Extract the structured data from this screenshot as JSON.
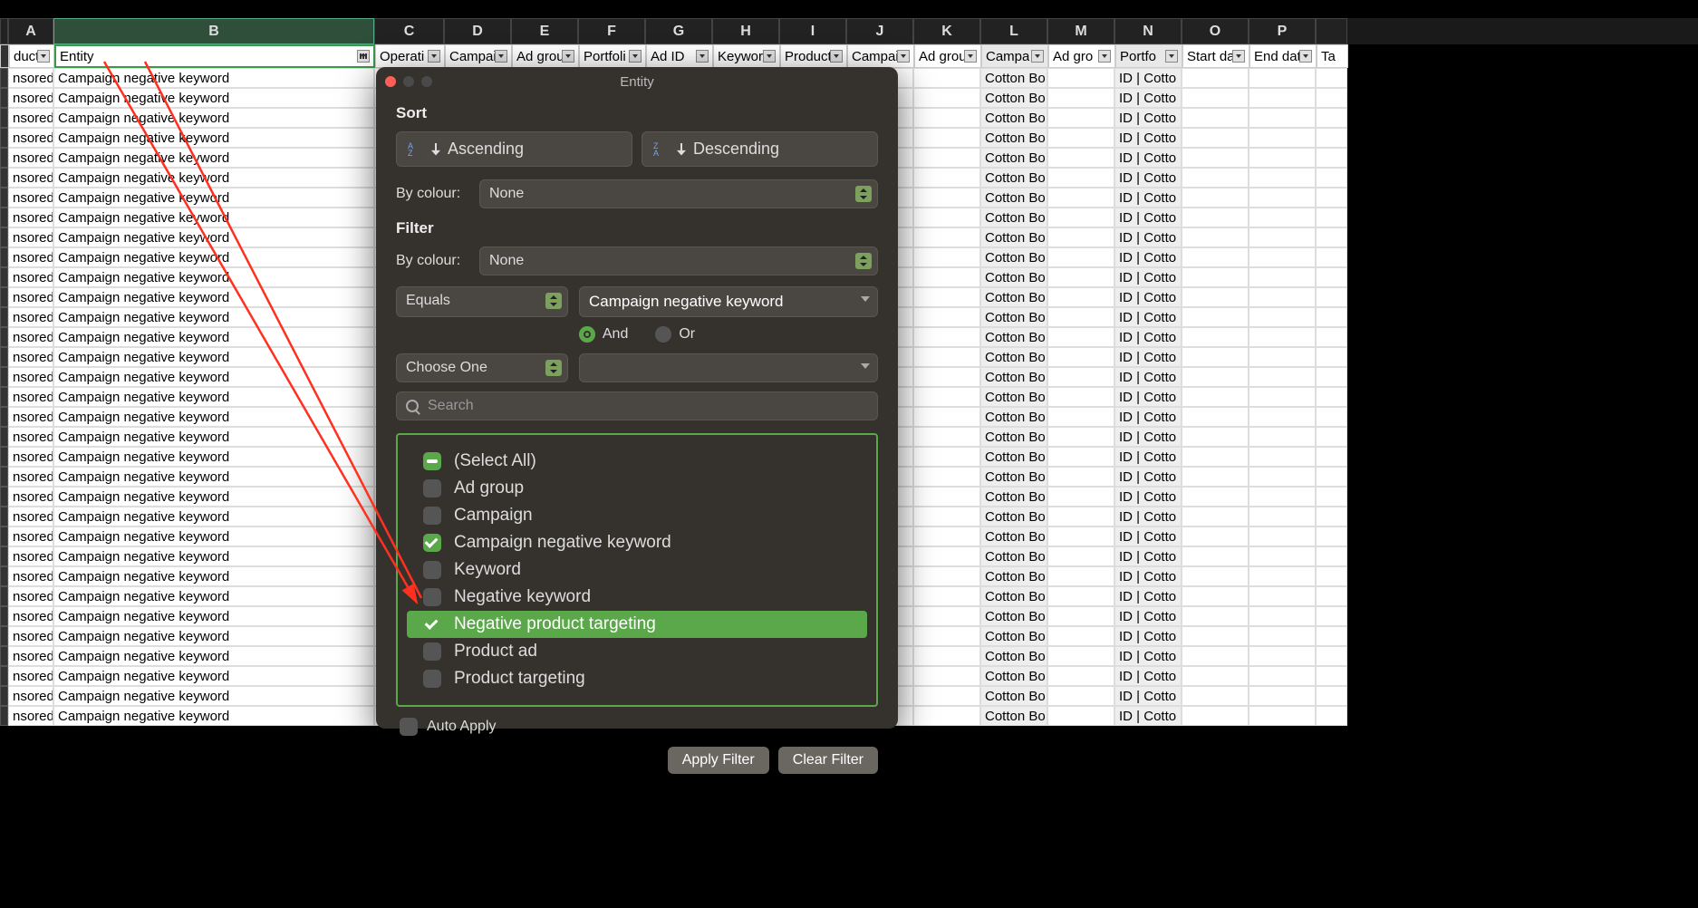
{
  "columns": [
    "A",
    "B",
    "C",
    "D",
    "E",
    "F",
    "G",
    "H",
    "I",
    "J",
    "K",
    "L",
    "M",
    "N",
    "O",
    "P"
  ],
  "filter_headers": {
    "A": "duct",
    "B": "Entity",
    "C": "Operati",
    "D": "Campai",
    "E": "Ad grou",
    "F": "Portfoli",
    "G": "Ad ID",
    "H": "Keywor",
    "I": "Product",
    "J": "Campai",
    "K": "Ad grou",
    "L": "Campa",
    "M": "Ad gro",
    "N": "Portfo",
    "O": "Start da",
    "P": "End dat",
    "Q": "Ta"
  },
  "row_data": {
    "A": "nsored",
    "B": "Campaign negative keyword",
    "L": "Cotton Bo",
    "N": "ID | Cotto"
  },
  "row_count": 33,
  "dialog": {
    "title": "Entity",
    "sort_label": "Sort",
    "asc": "Ascending",
    "desc": "Descending",
    "by_colour": "By colour:",
    "none": "None",
    "filter_label": "Filter",
    "equals": "Equals",
    "equals_value": "Campaign negative keyword",
    "and": "And",
    "or": "Or",
    "choose_one": "Choose One",
    "search_placeholder": "Search",
    "items": [
      {
        "label": "(Select All)",
        "state": "partial"
      },
      {
        "label": "Ad group",
        "state": "off"
      },
      {
        "label": "Campaign",
        "state": "off"
      },
      {
        "label": "Campaign negative keyword",
        "state": "checked"
      },
      {
        "label": "Keyword",
        "state": "off"
      },
      {
        "label": "Negative keyword",
        "state": "off"
      },
      {
        "label": "Negative product targeting",
        "state": "checked",
        "highlight": true
      },
      {
        "label": "Product ad",
        "state": "off"
      },
      {
        "label": "Product targeting",
        "state": "off"
      }
    ],
    "auto_apply": "Auto Apply",
    "apply": "Apply Filter",
    "clear": "Clear Filter"
  }
}
